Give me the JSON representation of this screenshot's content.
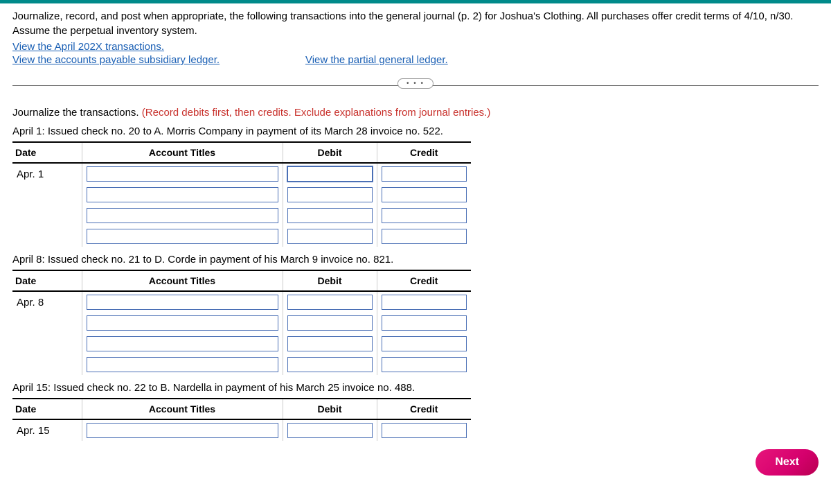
{
  "instructions": "Journalize, record, and post when appropriate, the following transactions into the general journal (p. 2) for Joshua's Clothing. All purchases offer credit terms of 4/10, n/30. Assume the perpetual inventory system.",
  "links": {
    "transactions": "View the April 202X transactions.",
    "ap_ledger": "View the accounts payable subsidiary ledger.",
    "gen_ledger": "View the partial general ledger."
  },
  "ellipsis": "• • •",
  "section": {
    "title": "Journalize the transactions. ",
    "hint": "(Record debits first, then credits. Exclude explanations from journal entries.)"
  },
  "headers": {
    "date": "Date",
    "account": "Account Titles",
    "debit": "Debit",
    "credit": "Credit"
  },
  "entries": [
    {
      "desc": "April 1: Issued check no. 20 to A. Morris Company in payment of its March 28 invoice no. 522.",
      "date": "Apr. 1",
      "rows": 4
    },
    {
      "desc": "April 8: Issued check no. 21 to D. Corde in payment of his March 9 invoice no. 821.",
      "date": "Apr. 8",
      "rows": 4
    },
    {
      "desc": "April 15: Issued check no. 22 to B. Nardella in payment of his March 25 invoice no. 488.",
      "date": "Apr. 15",
      "rows": 1
    }
  ],
  "next": "Next"
}
